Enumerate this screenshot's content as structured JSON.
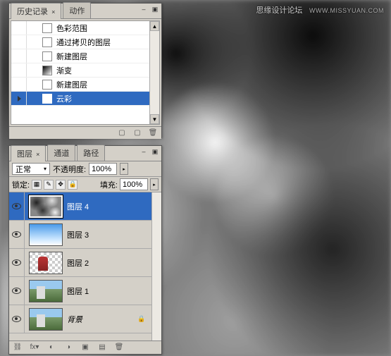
{
  "watermark": {
    "text": "思缘设计论坛",
    "url": "WWW.MISSYUAN.COM"
  },
  "history_panel": {
    "tabs": [
      {
        "label": "历史记录",
        "active": true
      },
      {
        "label": "动作",
        "active": false
      }
    ],
    "items": [
      {
        "label": "色彩范围",
        "icon": "doc",
        "selected": false
      },
      {
        "label": "通过拷贝的图层",
        "icon": "doc",
        "selected": false
      },
      {
        "label": "新建图层",
        "icon": "doc",
        "selected": false
      },
      {
        "label": "渐变",
        "icon": "gradient",
        "selected": false
      },
      {
        "label": "新建图层",
        "icon": "doc",
        "selected": false
      },
      {
        "label": "云彩",
        "icon": "doc",
        "selected": true
      }
    ]
  },
  "layers_panel": {
    "tabs": [
      {
        "label": "图层",
        "active": true
      },
      {
        "label": "通道",
        "active": false
      },
      {
        "label": "路径",
        "active": false
      }
    ],
    "blend_label": "正常",
    "opacity_label": "不透明度:",
    "opacity_value": "100%",
    "lock_label": "锁定:",
    "fill_label": "填充:",
    "fill_value": "100%",
    "layers": [
      {
        "name": "图层 4",
        "thumb": "clouds",
        "selected": true,
        "visible": true,
        "italic": false,
        "locked": false
      },
      {
        "name": "图层 3",
        "thumb": "sky",
        "selected": false,
        "visible": true,
        "italic": false,
        "locked": false
      },
      {
        "name": "图层 2",
        "thumb": "trans",
        "selected": false,
        "visible": true,
        "italic": false,
        "locked": false
      },
      {
        "name": "图层 1",
        "thumb": "photo",
        "selected": false,
        "visible": true,
        "italic": false,
        "locked": false
      },
      {
        "name": "背景",
        "thumb": "photo",
        "selected": false,
        "visible": true,
        "italic": true,
        "locked": true
      }
    ]
  }
}
